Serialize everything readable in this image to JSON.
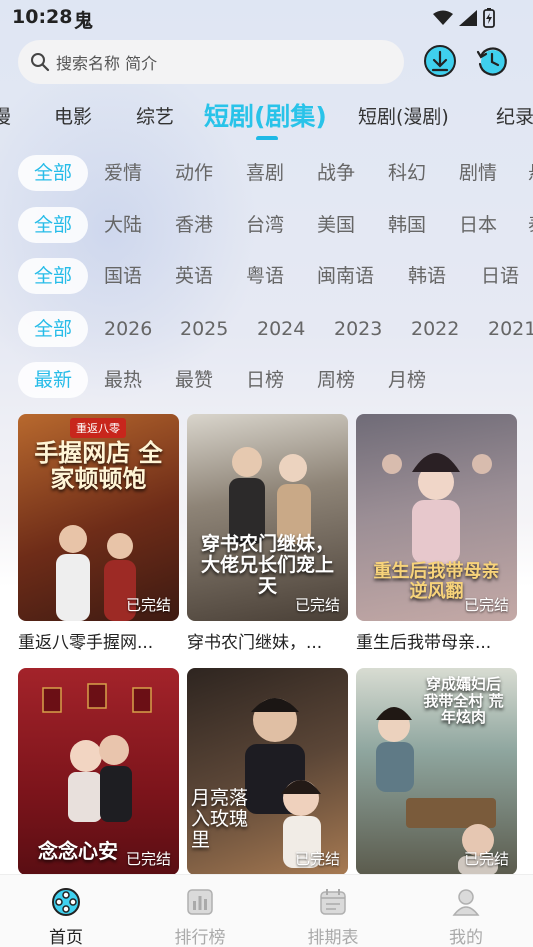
{
  "status": {
    "time": "10:28",
    "app_glyph": "鬼"
  },
  "search": {
    "placeholder": "搜索名称 简介",
    "download_icon": "download-icon",
    "history_icon": "history-icon"
  },
  "categories": [
    {
      "label": "漫"
    },
    {
      "label": "电影"
    },
    {
      "label": "综艺"
    },
    {
      "label": "短剧(剧集)",
      "active": true
    },
    {
      "label": "短剧(漫剧)"
    },
    {
      "label": "纪录"
    }
  ],
  "filters": {
    "genre": [
      "全部",
      "爱情",
      "动作",
      "喜剧",
      "战争",
      "科幻",
      "剧情",
      "悬"
    ],
    "region": [
      "全部",
      "大陆",
      "香港",
      "台湾",
      "美国",
      "韩国",
      "日本",
      "泰"
    ],
    "language": [
      "全部",
      "国语",
      "英语",
      "粤语",
      "闽南语",
      "韩语",
      "日语"
    ],
    "year": [
      "全部",
      "2026",
      "2025",
      "2024",
      "2023",
      "2022",
      "2021"
    ],
    "sort": [
      "最新",
      "最热",
      "最赞",
      "日榜",
      "周榜",
      "月榜"
    ]
  },
  "cards": [
    {
      "title": "重返八零手握网...",
      "badge": "已完结",
      "poster_text": "手握网店 全家顿顿饱",
      "poster_tag": "重返八零",
      "bg": "#7a3b22"
    },
    {
      "title": "穿书农门继妹，...",
      "badge": "已完结",
      "poster_text": "穿书农门继妹，大佬兄长们宠上天",
      "bg": "#6f6a63"
    },
    {
      "title": "重生后我带母亲...",
      "badge": "已完结",
      "poster_text": "重生后我带母亲 逆风翻",
      "bg": "#8a7d86"
    },
    {
      "title": "",
      "badge": "已完结",
      "poster_text": "念念心安",
      "bg": "#8d1d22"
    },
    {
      "title": "",
      "badge": "已完结",
      "poster_text": "月亮落入玫瑰里",
      "bg": "#4a3a32"
    },
    {
      "title": "",
      "badge": "已完结",
      "poster_text": "穿成孀妇后 我带全村 荒年炫肉",
      "bg": "#6a8a8b"
    }
  ],
  "nav": [
    {
      "label": "首页",
      "icon": "film-reel-icon",
      "active": true
    },
    {
      "label": "排行榜",
      "icon": "bar-chart-icon"
    },
    {
      "label": "排期表",
      "icon": "calendar-icon"
    },
    {
      "label": "我的",
      "icon": "user-icon"
    }
  ]
}
